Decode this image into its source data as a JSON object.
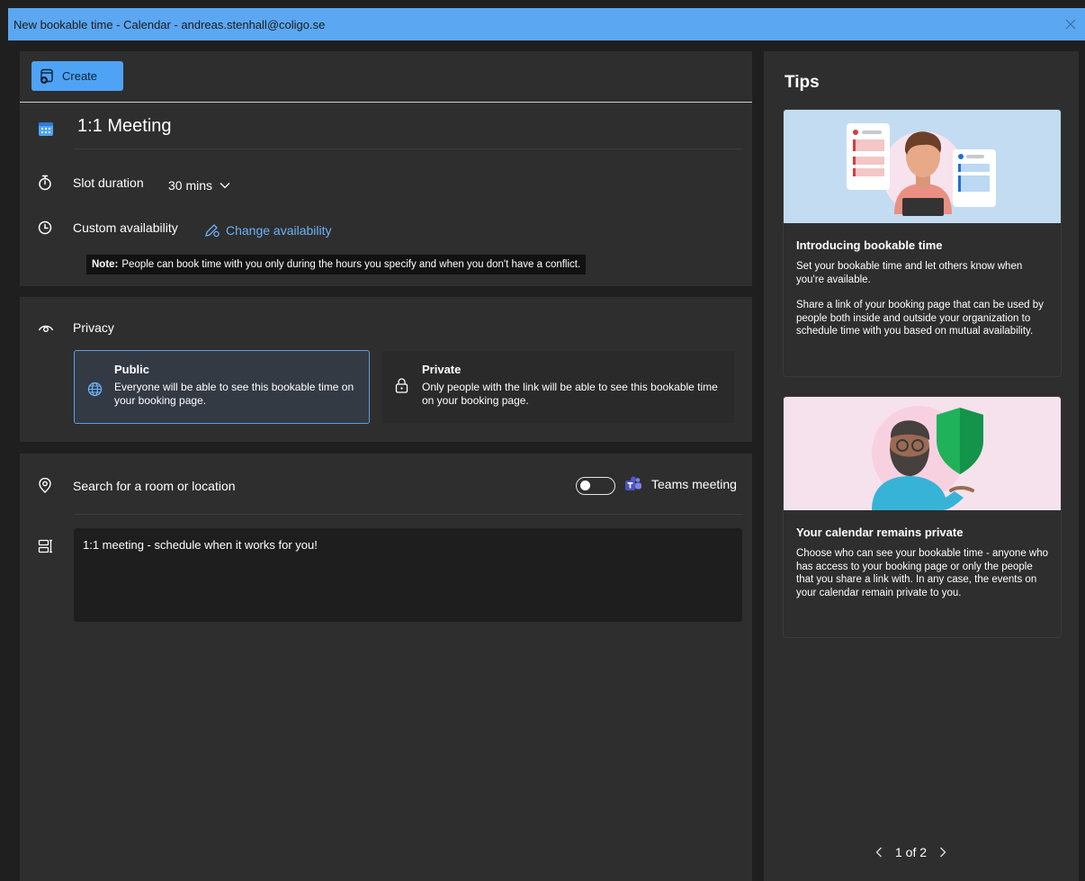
{
  "window": {
    "title": "New bookable time - Calendar - andreas.stenhall@coligo.se"
  },
  "toolbar": {
    "create_label": "Create"
  },
  "meeting": {
    "title": "1:1 Meeting",
    "slot_label": "Slot duration",
    "slot_value": "30 mins",
    "availability_label": "Custom availability",
    "change_availability": "Change availability",
    "note_bold": "Note:",
    "note_text": "People can book time with you only during the hours you specify and when you don't have a conflict."
  },
  "privacy": {
    "label": "Privacy",
    "public_title": "Public",
    "public_desc": "Everyone will be able to see this bookable time on your booking page.",
    "private_title": "Private",
    "private_desc": "Only people with the link will be able to see this bookable time on your booking page.",
    "selected": "Public"
  },
  "location": {
    "placeholder": "Search for a room or location",
    "teams_label": "Teams meeting",
    "teams_enabled": false,
    "description": "1:1 meeting - schedule when it works for you!"
  },
  "tips": {
    "title": "Tips",
    "cards": [
      {
        "heading": "Introducing bookable time",
        "para1": "Set your bookable time and let others know when you're available.",
        "para2": "Share a link of your booking page that can be used by people both inside and outside your organization to schedule time with you based on mutual availability."
      },
      {
        "heading": "Your calendar remains private",
        "para1": "Choose who can see your bookable time - anyone who has access to your booking page or only the people that you share a link with. In any case, the events on your calendar remain private to you."
      }
    ],
    "pager": "1 of 2"
  },
  "colors": {
    "accent": "#4fa3f5",
    "titlebar": "#5ba7f2",
    "panel": "#2e2e2e",
    "background": "#1f1f1f"
  }
}
